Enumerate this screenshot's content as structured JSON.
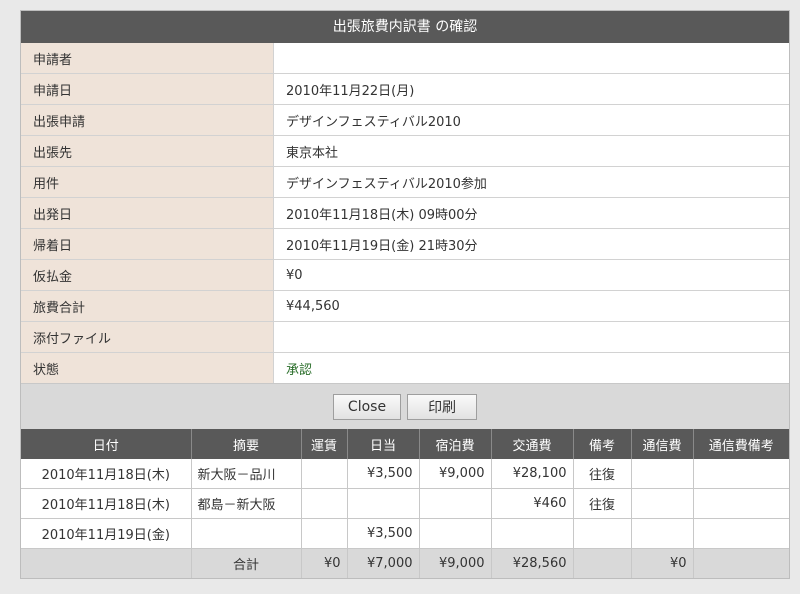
{
  "title": "出張旅費内訳書 の確認",
  "info_rows": [
    {
      "label": "申請者",
      "value": ""
    },
    {
      "label": "申請日",
      "value": "2010年11月22日(月)"
    },
    {
      "label": "出張申請",
      "value": "デザインフェスティバル2010"
    },
    {
      "label": "出張先",
      "value": "東京本社"
    },
    {
      "label": "用件",
      "value": "デザインフェスティバル2010参加"
    },
    {
      "label": "出発日",
      "value": "2010年11月18日(木) 09時00分"
    },
    {
      "label": "帰着日",
      "value": "2010年11月19日(金) 21時30分"
    },
    {
      "label": "仮払金",
      "value": "¥0"
    },
    {
      "label": "旅費合計",
      "value": "¥44,560"
    },
    {
      "label": "添付ファイル",
      "value": ""
    },
    {
      "label": "状態",
      "value": "承認"
    }
  ],
  "buttons": {
    "close": "Close",
    "print": "印刷"
  },
  "detail": {
    "headers": [
      "日付",
      "摘要",
      "運賃",
      "日当",
      "宿泊費",
      "交通費",
      "備考",
      "通信費",
      "通信費備考"
    ],
    "rows": [
      [
        "2010年11月18日(木)",
        "新大阪－品川",
        "",
        "¥3,500",
        "¥9,000",
        "¥28,100",
        "往復",
        "",
        ""
      ],
      [
        "2010年11月18日(木)",
        "都島－新大阪",
        "",
        "",
        "",
        "¥460",
        "往復",
        "",
        ""
      ],
      [
        "2010年11月19日(金)",
        "",
        "",
        "¥3,500",
        "",
        "",
        "",
        "",
        ""
      ]
    ],
    "total": [
      "",
      "合計",
      "¥0",
      "¥7,000",
      "¥9,000",
      "¥28,560",
      "",
      "¥0",
      ""
    ]
  }
}
